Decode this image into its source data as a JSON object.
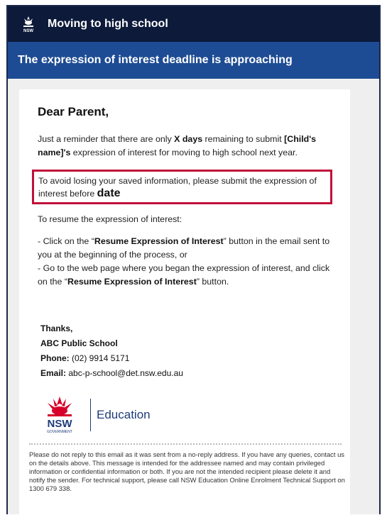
{
  "header": {
    "app_title": "Moving to high school",
    "banner": "The expression of interest deadline is approaching"
  },
  "email": {
    "greeting": "Dear Parent,",
    "reminder": {
      "pre": "Just a reminder that there are only ",
      "days": "X days",
      "mid": " remaining to submit ",
      "child": "[Child's name]'s",
      "post": " expression of interest for moving to high school next year."
    },
    "warning": {
      "text": "To avoid losing your saved information, please submit the expression of interest before ",
      "date": "date"
    },
    "resume_intro": "To resume the expression of interest:",
    "option1": {
      "pre": "- Click on the “",
      "button": "Resume Expression of Interest",
      "post": "” button in the email sent to you at the beginning of the process, or"
    },
    "option2": {
      "pre": "- Go to the web page where you began the expression of interest, and click on the “",
      "button": "Resume Expression of Interest",
      "post": "” button."
    },
    "signature": {
      "thanks": "Thanks,",
      "school": "ABC  Public School",
      "phone_label": "Phone:",
      "phone": " (02) 9914 5171",
      "email_label": "Email:",
      "email": " abc-p-school@det.nsw.edu.au"
    },
    "brand": {
      "nsw": "NSW",
      "government": "GOVERNMENT",
      "education": "Education"
    },
    "footer": "Please do not reply to this email as it was sent from a no-reply address. If you have any queries, contact us on the details above. This message is intended for the addressee named and may contain privileged information or confidential information or both. If you are not the intended recipient please delete it and notify the sender. For technical support, please call NSW Education Online Enrolment Technical Support on 1300 679 338."
  },
  "colors": {
    "topbar": "#0d1a3a",
    "banner": "#1e4c94",
    "highlight_border": "#c0103a",
    "waratah_red": "#d6002a",
    "brand_navy": "#1e3c7a"
  }
}
